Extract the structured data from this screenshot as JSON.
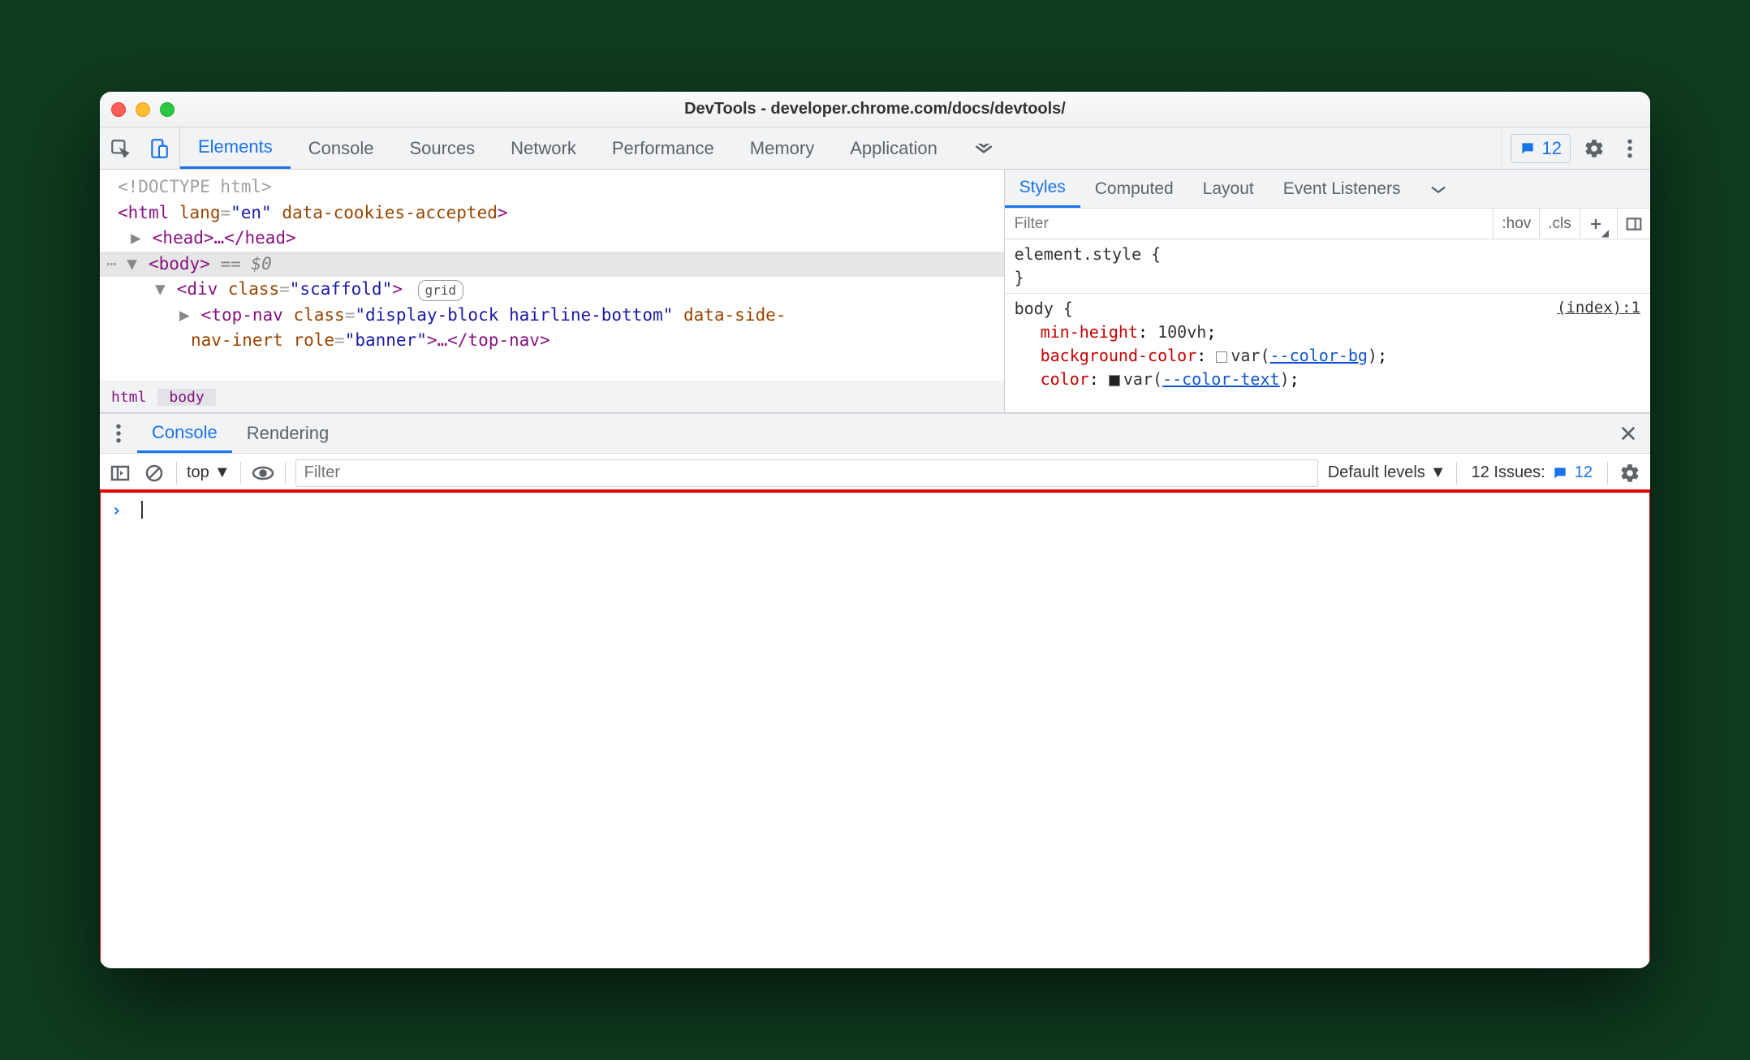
{
  "window": {
    "title": "DevTools - developer.chrome.com/docs/devtools/"
  },
  "mainTabs": {
    "items": [
      "Elements",
      "Console",
      "Sources",
      "Network",
      "Performance",
      "Memory",
      "Application"
    ],
    "activeIndex": 0,
    "issuesCount": "12"
  },
  "dom": {
    "l1": "<!DOCTYPE html>",
    "l2_open": "<",
    "l2_tag": "html",
    "l2_attr1_name": "lang",
    "l2_attr1_val": "\"en\"",
    "l2_attr2_name": "data-cookies-accepted",
    "l2_close": ">",
    "l3_open": "<",
    "l3_tag": "head",
    "l3_mid": ">…</",
    "l3_end": ">",
    "l4_open": "<",
    "l4_tag": "body",
    "l4_close": ">",
    "l4_eq": " == $0",
    "l5_open": "<",
    "l5_tag": "div",
    "l5_attr_name": "class",
    "l5_attr_val": "\"scaffold\"",
    "l5_close": ">",
    "l5_badge": "grid",
    "l6_open": "<",
    "l6_tag": "top-nav",
    "l6_a1_name": "class",
    "l6_a1_val": "\"display-block hairline-bottom\"",
    "l6_a2_name": "data-side-",
    "l6_line2_a": "nav-inert",
    "l6_line2_b_name": "role",
    "l6_line2_b_val": "\"banner\"",
    "l6_mid": ">…</",
    "l6_tag2": "top-nav",
    "l6_end": ">"
  },
  "breadcrumbs": {
    "item0": "html",
    "item1": "body"
  },
  "stylesTabs": {
    "items": [
      "Styles",
      "Computed",
      "Layout",
      "Event Listeners"
    ],
    "activeIndex": 0
  },
  "stylesFilter": {
    "placeholder": "Filter",
    "hov": ":hov",
    "cls": ".cls"
  },
  "stylesRules": {
    "r0_line1": "element.style {",
    "r0_line2": "}",
    "r1_sel": "body {",
    "r1_origin": "(index):1",
    "r1_p1_name": "min-height",
    "r1_p1_val": "100vh",
    "r1_p2_name": "background-color",
    "r1_p2_func": "var(",
    "r1_p2_var": "--color-bg",
    "r1_p2_end": ")",
    "r1_p3_name": "color",
    "r1_p3_func": "var(",
    "r1_p3_var": "--color-text",
    "r1_p3_end": ")"
  },
  "drawer": {
    "tabs": [
      "Console",
      "Rendering"
    ],
    "activeIndex": 0
  },
  "consoleToolbar": {
    "context": "top",
    "filterPlaceholder": "Filter",
    "levels": "Default levels",
    "issuesLabel": "12 Issues:",
    "issuesCount": "12"
  }
}
